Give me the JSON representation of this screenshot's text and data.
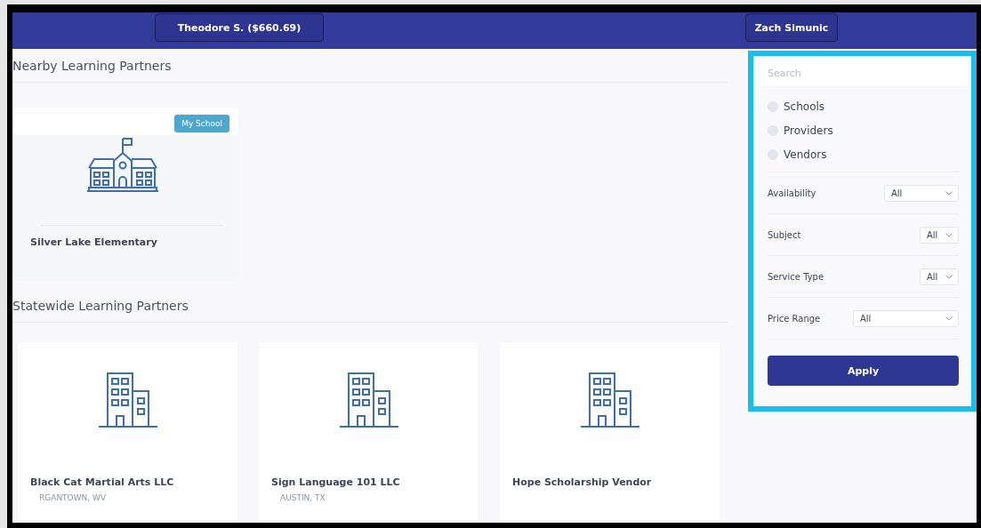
{
  "header": {
    "account_button": "Theodore S. ($660.69)",
    "user_button": "Zach Simunic"
  },
  "nearby": {
    "title": "Nearby Learning Partners",
    "cards": [
      {
        "kind": "school",
        "badge": "My School",
        "name": "Silver Lake Elementary"
      }
    ]
  },
  "statewide": {
    "title": "Statewide Learning Partners",
    "cards": [
      {
        "kind": "building",
        "name": "Black Cat Martial Arts LLC",
        "location": "RGANTOWN, WV"
      },
      {
        "kind": "building",
        "name": "Sign Language 101 LLC",
        "location": "AUSTIN, TX"
      },
      {
        "kind": "building",
        "name": "Hope Scholarship Vendor"
      }
    ]
  },
  "filters": {
    "search": {
      "placeholder": "Search"
    },
    "types": [
      {
        "label": "Schools",
        "checked": false
      },
      {
        "label": "Providers",
        "checked": false
      },
      {
        "label": "Vendors",
        "checked": false
      }
    ],
    "selects": [
      {
        "label": "Availability",
        "value": "All"
      },
      {
        "label": "Subject",
        "value": "All"
      },
      {
        "label": "Service Type",
        "value": "All"
      },
      {
        "label": "Price Range",
        "value": "All"
      }
    ],
    "apply_button": "Apply"
  }
}
